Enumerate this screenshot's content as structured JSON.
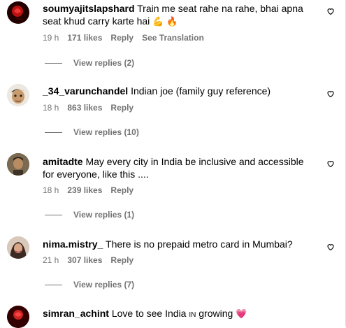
{
  "comments": [
    {
      "username": "soumyajitslapshard",
      "text": "Train me seat rahe na rahe, bhai apna seat khud carry karte hai",
      "emojis": "💪 🔥",
      "time": "19 h",
      "likes": "171 likes",
      "reply": "Reply",
      "translation": "See Translation",
      "view_replies": "View replies (2)"
    },
    {
      "username": "_34_varunchandel",
      "text": "Indian joe (family guy reference)",
      "time": "18 h",
      "likes": "863 likes",
      "reply": "Reply",
      "view_replies": "View replies (10)"
    },
    {
      "username": "amitadte",
      "text": "May every city in India be inclusive and accessible for everyone, like this ....",
      "time": "18 h",
      "likes": "239 likes",
      "reply": "Reply",
      "view_replies": "View replies (1)"
    },
    {
      "username": "nima.mistry_",
      "text": "There is no prepaid metro card in Mumbai?",
      "time": "21 h",
      "likes": "307 likes",
      "reply": "Reply",
      "view_replies": "View replies (7)"
    },
    {
      "username": "simran_achint",
      "text_before": "Love to see India",
      "text_smallcaps": "in",
      "text_after": "growing",
      "emoji": "💗"
    }
  ],
  "colors": {
    "secondary_text": "#737373",
    "primary_text": "#000000"
  },
  "icons": {
    "like": "heart-outline-icon"
  }
}
